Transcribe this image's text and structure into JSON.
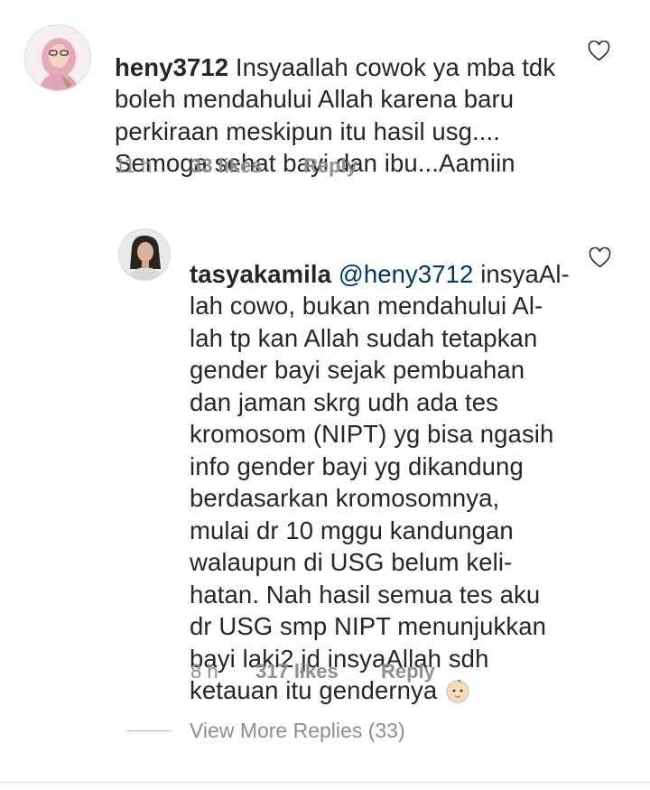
{
  "comments": [
    {
      "username": "heny3712",
      "text": " Insyaallah cowok ya mba tdk\nboleh mendahului Allah karena baru\nperkiraan meskipun itu hasil usg....\nSemoga sehat bayi dan ibu...Aamiin",
      "time": "11 h",
      "likes": "33 likes",
      "reply": "Reply",
      "avatar_icon": "profile-photo"
    },
    {
      "username": "tasyakamila",
      "mention": "@heny3712",
      "text": " insyaAl-\nlah cowo, bukan mendahului Al-\nlah tp kan Allah sudah tetapkan\ngender bayi sejak pembuahan\ndan jaman skrg udh ada tes\nkromosom (NIPT) yg bisa ngasih\ninfo gender bayi yg dikandung\nberdasarkan kromosomnya,\nmulai dr 10 mggu kandungan\nwalaupun di USG belum keli-\nhatan. Nah hasil semua tes aku\ndr USG smp NIPT menunjukkan\nbayi laki2 jd insyaAllah sdh\nketauan itu gendernya ",
      "emoji": "baby-emoji",
      "time": "8 h",
      "likes": "317 likes",
      "reply": "Reply",
      "avatar_icon": "profile-photo"
    }
  ],
  "view_more": "View More Replies (33)",
  "colors": {
    "text": "#262626",
    "meta": "#8e8e8e",
    "mention": "#00376b"
  }
}
